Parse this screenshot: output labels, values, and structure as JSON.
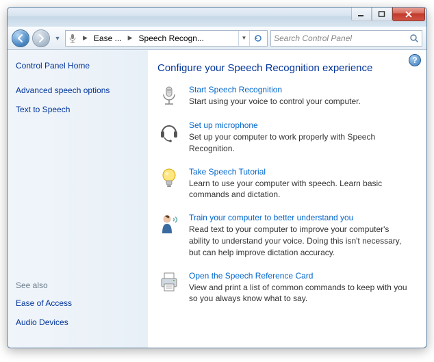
{
  "breadcrumb": {
    "level1": "Ease ...",
    "level2": "Speech Recogn..."
  },
  "search": {
    "placeholder": "Search Control Panel"
  },
  "sidebar": {
    "home": "Control Panel Home",
    "links": [
      {
        "label": "Advanced speech options"
      },
      {
        "label": "Text to Speech"
      }
    ],
    "seealso_header": "See also",
    "seealso": [
      {
        "label": "Ease of Access"
      },
      {
        "label": "Audio Devices"
      }
    ]
  },
  "main": {
    "heading": "Configure your Speech Recognition experience",
    "tasks": [
      {
        "title": "Start Speech Recognition",
        "desc": "Start using your voice to control your computer."
      },
      {
        "title": "Set up microphone",
        "desc": "Set up your computer to work properly with Speech Recognition."
      },
      {
        "title": "Take Speech Tutorial",
        "desc": "Learn to use your computer with speech.  Learn basic commands and dictation."
      },
      {
        "title": "Train your computer to better understand you",
        "desc": "Read text to your computer to improve your computer's ability to understand your voice.  Doing this isn't necessary, but can help improve dictation accuracy."
      },
      {
        "title": "Open the Speech Reference Card",
        "desc": "View and print a list of common commands to keep with you so you always know what to say."
      }
    ]
  }
}
